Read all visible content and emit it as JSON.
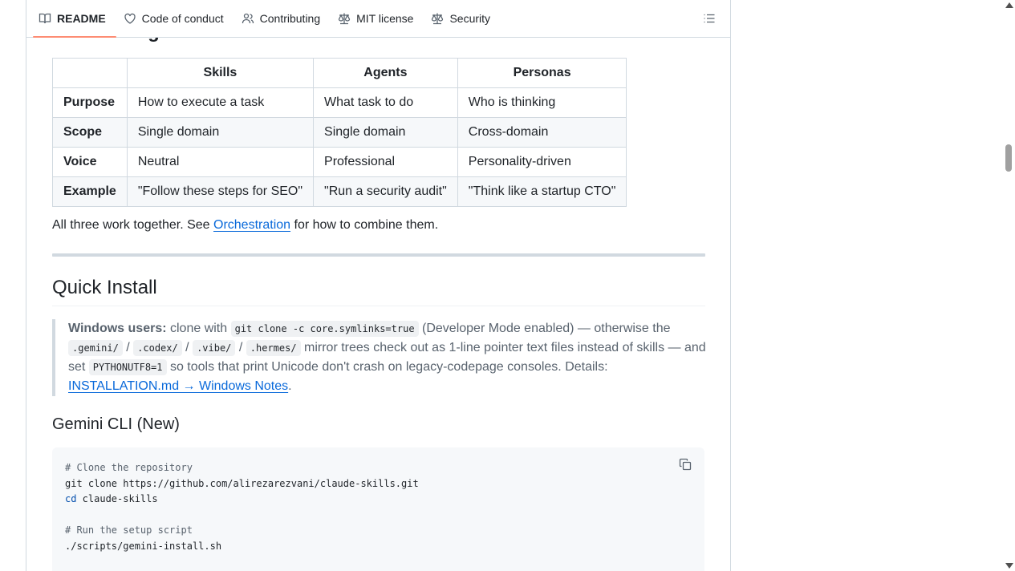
{
  "tabs": [
    {
      "label": "README",
      "icon": "book-icon",
      "active": true
    },
    {
      "label": "Code of conduct",
      "icon": "heart-icon"
    },
    {
      "label": "Contributing",
      "icon": "people-icon"
    },
    {
      "label": "MIT license",
      "icon": "scale-icon"
    },
    {
      "label": "Security",
      "icon": "scale-icon"
    }
  ],
  "outline_icon": "list-unordered-icon",
  "cut_heading": "Skills vs Agents vs Personas",
  "table": {
    "headers": [
      "",
      "Skills",
      "Agents",
      "Personas"
    ],
    "rows": [
      [
        "Purpose",
        "How to execute a task",
        "What task to do",
        "Who is thinking"
      ],
      [
        "Scope",
        "Single domain",
        "Single domain",
        "Cross-domain"
      ],
      [
        "Voice",
        "Neutral",
        "Professional",
        "Personality-driven"
      ],
      [
        "Example",
        "\"Follow these steps for SEO\"",
        "\"Run a security audit\"",
        "\"Think like a startup CTO\""
      ]
    ]
  },
  "para": {
    "before": "All three work together. See ",
    "link": "Orchestration",
    "after": " for how to combine them."
  },
  "install_heading": "Quick Install",
  "note": {
    "bold": "Windows users:",
    "t1": " clone with ",
    "code1": "git clone -c core.symlinks=true",
    "t2": " (Developer Mode enabled) — otherwise the ",
    "code2": ".gemini/",
    "sep1": " / ",
    "code3": ".codex/",
    "sep2": " / ",
    "code4": ".vibe/",
    "sep3": " / ",
    "code5": ".hermes/",
    "t3": " mirror trees check out as 1-line pointer text files instead of skills — and set ",
    "code6": "PYTHONUTF8=1",
    "t4": " so tools that print Unicode don't crash on legacy-codepage consoles. Details: ",
    "link": "INSTALLATION.md → Windows Notes",
    "t5": "."
  },
  "gemini_heading": "Gemini CLI (New)",
  "code": {
    "c1": "# Clone the repository",
    "l1": "git clone https://github.com/alirezarezvani/claude-skills.git",
    "l2_kw": "cd",
    "l2_rest": " claude-skills",
    "c2": "# Run the setup script",
    "l3": "./scripts/gemini-install.sh"
  },
  "copy_icon": "copy-icon"
}
